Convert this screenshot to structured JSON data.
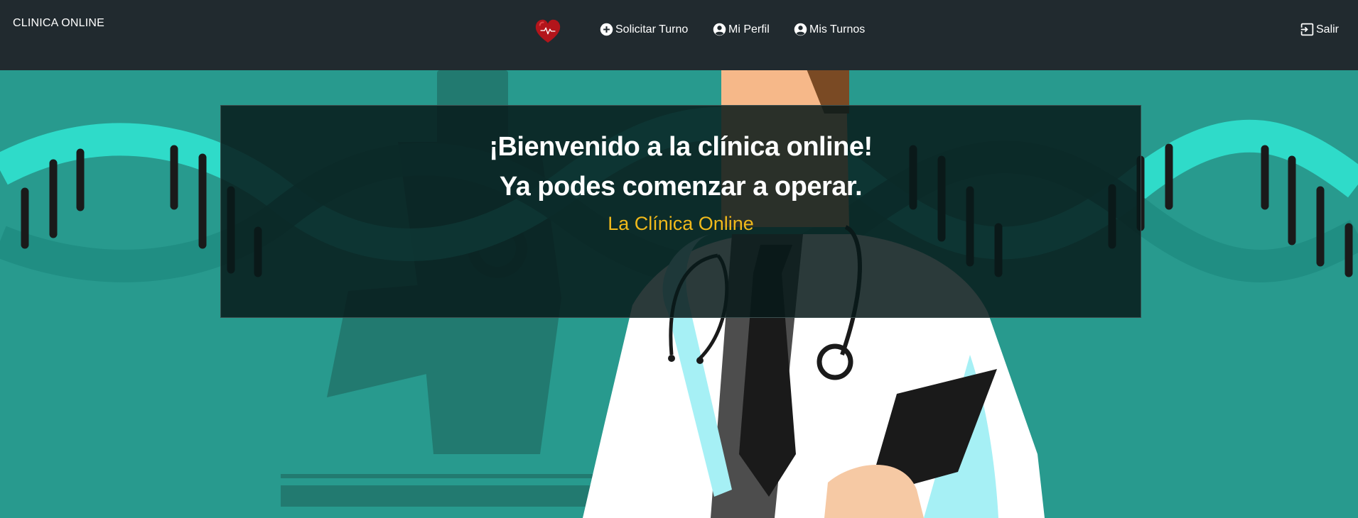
{
  "navbar": {
    "brand": "CLINICA ONLINE",
    "logo_icon": "heart-pulse-icon",
    "items": [
      {
        "label": "Solicitar Turno",
        "icon": "plus-circle-icon"
      },
      {
        "label": "Mi Perfil",
        "icon": "user-circle-icon"
      },
      {
        "label": "Mis Turnos",
        "icon": "user-circle-icon"
      }
    ],
    "logout": {
      "label": "Salir",
      "icon": "logout-icon"
    }
  },
  "hero": {
    "title_line1": "¡Bienvenido a la clínica online!",
    "title_line2": "Ya podes comenzar a operar.",
    "subtitle": "La Clínica Online"
  },
  "colors": {
    "navbar": "#212a2f",
    "background": "#289a8e",
    "accent": "#f0b91b",
    "heart": "#b3151b"
  }
}
